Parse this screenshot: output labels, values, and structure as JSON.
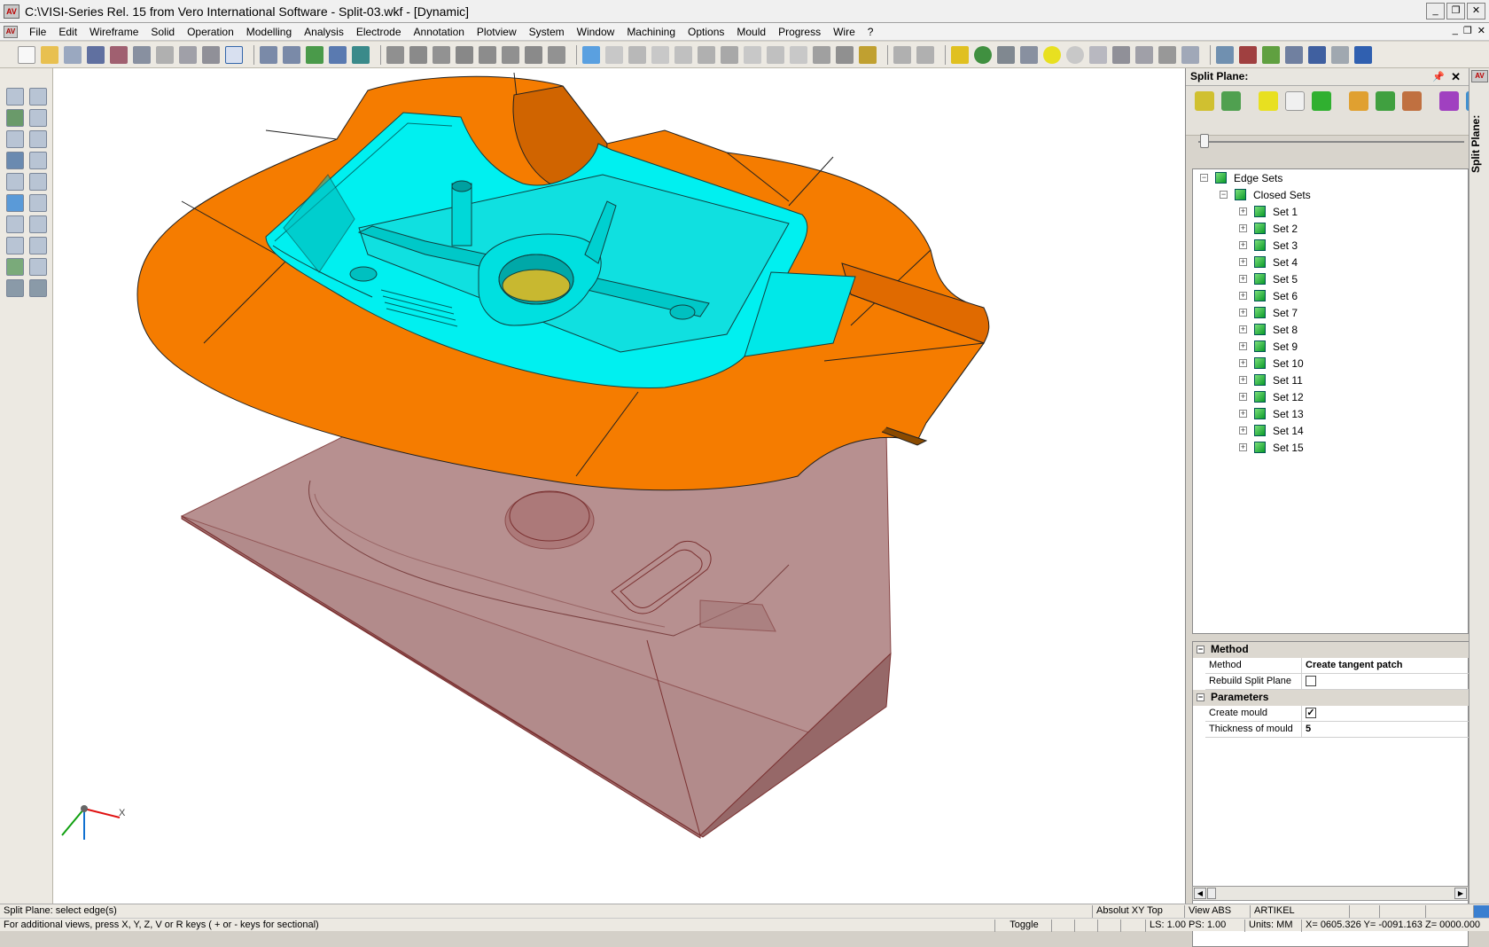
{
  "window": {
    "title": "C:\\VISI-Series Rel. 15 from Vero International Software - Split-03.wkf - [Dynamic]",
    "app_logo": "AV",
    "controls": [
      "_",
      "❐",
      "✕"
    ]
  },
  "menubar": {
    "items": [
      "File",
      "Edit",
      "Wireframe",
      "Solid",
      "Operation",
      "Modelling",
      "Analysis",
      "Electrode",
      "Annotation",
      "Plotview",
      "System",
      "Window",
      "Machining",
      "Options",
      "Mould",
      "Progress",
      "Wire",
      "?"
    ],
    "mdi_controls": [
      "_",
      "❐",
      "✕"
    ]
  },
  "panel": {
    "title": "Split Plane:",
    "pin_icon": "📌",
    "close_icon": "✕",
    "vertical_tab": "Split Plane:",
    "tree": {
      "root": "Edge Sets",
      "child": "Closed Sets",
      "sets": [
        "Set 1",
        "Set 2",
        "Set 3",
        "Set 4",
        "Set 5",
        "Set 6",
        "Set 7",
        "Set 8",
        "Set 9",
        "Set 10",
        "Set 11",
        "Set 12",
        "Set 13",
        "Set 14",
        "Set 15"
      ]
    },
    "properties": {
      "method_section": "Method",
      "method_label": "Method",
      "method_value": "Create tangent patch",
      "rebuild_label": "Rebuild Split Plane",
      "rebuild_checked": false,
      "params_section": "Parameters",
      "create_mould_label": "Create mould",
      "create_mould_checked": true,
      "thickness_label": "Thickness of mould",
      "thickness_value": "5"
    },
    "slider_value": 0
  },
  "viewport": {
    "axis_x_label": "X",
    "colors": {
      "orange": "#f57c00",
      "cyan": "#00f0f0",
      "mould": "#b08080"
    }
  },
  "status": {
    "prompt": "Split Plane: select edge(s)",
    "hint": "For additional views, press X, Y, Z, V or R keys ( + or - keys for sectional)",
    "view_mode": "Absolut XY Top",
    "view_abs": "View ABS",
    "layer": "ARTIKEL",
    "toggle": "Toggle",
    "ls_ps": "LS: 1.00 PS: 1.00",
    "units": "Units: MM",
    "coords": "X= 0605.326 Y= -0091.163 Z= 0000.000"
  }
}
